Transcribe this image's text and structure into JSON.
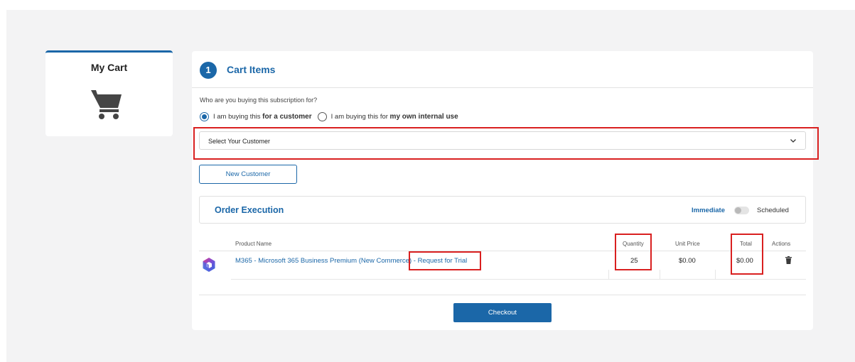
{
  "sidebar": {
    "title": "My Cart",
    "icon": "shopping-cart-icon"
  },
  "step": {
    "number": "1",
    "title": "Cart Items"
  },
  "buyer": {
    "question": "Who are you buying this subscription for?",
    "options": [
      {
        "prefix": "I am buying this ",
        "emphasis": "for a customer",
        "checked": true
      },
      {
        "prefix": "I am buying this for ",
        "emphasis": "my own internal use",
        "checked": false
      }
    ]
  },
  "customer_select": {
    "selected": "Select Your Customer"
  },
  "new_customer_label": "New Customer",
  "order_execution": {
    "title": "Order Execution",
    "immediate_label": "Immediate",
    "scheduled_label": "Scheduled",
    "toggle_on": false
  },
  "table": {
    "headers": {
      "product": "Product Name",
      "quantity": "Quantity",
      "unit_price": "Unit Price",
      "total": "Total",
      "actions": "Actions"
    },
    "rows": [
      {
        "product_name": "M365 - Microsoft 365 Business Premium (New Commerce)",
        "product_suffix": " - Request for Trial",
        "quantity": "25",
        "unit_price": "$0.00",
        "total": "$0.00",
        "icon": "microsoft-365-logo-icon"
      }
    ]
  },
  "checkout_label": "Checkout",
  "colors": {
    "accent": "#1b67a8",
    "highlight": "#d92020"
  }
}
